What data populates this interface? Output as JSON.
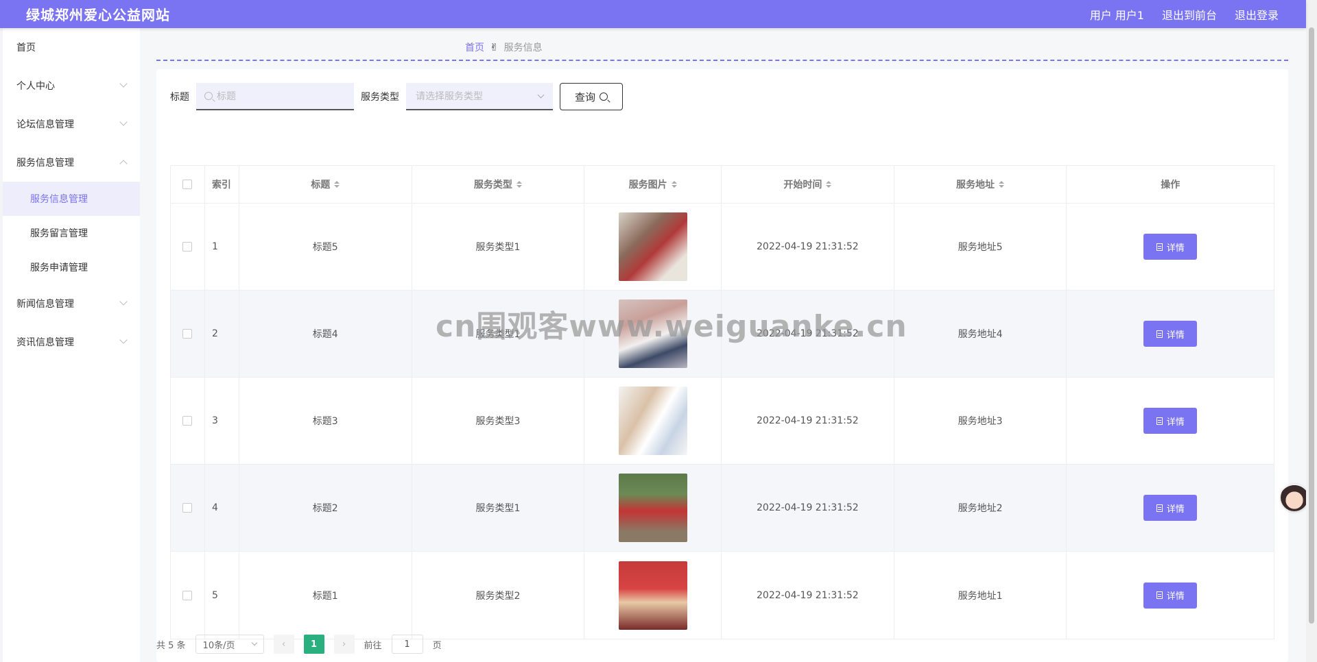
{
  "header": {
    "brand": "绿城郑州爱心公益网站",
    "user": "用户 用户1",
    "to_front": "退出到前台",
    "logout": "退出登录"
  },
  "sidebar": {
    "home": "首页",
    "personal": "个人中心",
    "forum": "论坛信息管理",
    "service": "服务信息管理",
    "service_sub": [
      "服务信息管理",
      "服务留言管理",
      "服务申请管理"
    ],
    "news": "新闻信息管理",
    "info": "资讯信息管理"
  },
  "breadcrumb": {
    "home": "首页",
    "current": "服务信息"
  },
  "search": {
    "title_label": "标题",
    "title_placeholder": "标题",
    "type_label": "服务类型",
    "type_placeholder": "请选择服务类型",
    "query_button": "查询"
  },
  "table": {
    "columns": [
      "索引",
      "标题",
      "服务类型",
      "服务图片",
      "开始时间",
      "服务地址",
      "操作"
    ],
    "rows": [
      {
        "index": "1",
        "title": "标题5",
        "type": "服务类型1",
        "time": "2022-04-19 21:31:52",
        "address": "服务地址5"
      },
      {
        "index": "2",
        "title": "标题4",
        "type": "服务类型1",
        "time": "2022-04-19 21:31:52",
        "address": "服务地址4"
      },
      {
        "index": "3",
        "title": "标题3",
        "type": "服务类型3",
        "time": "2022-04-19 21:31:52",
        "address": "服务地址3"
      },
      {
        "index": "4",
        "title": "标题2",
        "type": "服务类型1",
        "time": "2022-04-19 21:31:52",
        "address": "服务地址2"
      },
      {
        "index": "5",
        "title": "标题1",
        "type": "服务类型2",
        "time": "2022-04-19 21:31:52",
        "address": "服务地址1"
      }
    ],
    "detail_label": "详情"
  },
  "pager": {
    "total": "共 5 条",
    "page_size": "10条/页",
    "current": "1",
    "goto_prefix": "前往",
    "goto_value": "1",
    "goto_suffix": "页"
  },
  "watermark": "cn围观客www.weiguanke.cn",
  "colors": {
    "accent": "#7a73f2",
    "page_active": "#2ab07f"
  }
}
